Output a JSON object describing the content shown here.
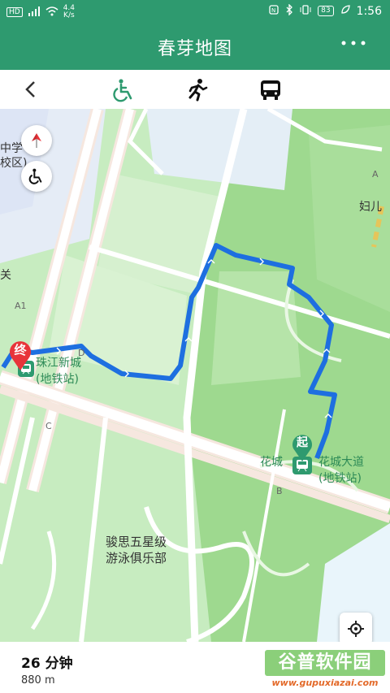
{
  "status_bar": {
    "network_badge": "HD",
    "signal": "4G",
    "speed_value": "4.4",
    "speed_unit": "K/s",
    "battery": "83",
    "time": "1:56"
  },
  "header": {
    "title": "春芽地图"
  },
  "mode_bar": {
    "active_mode": "wheelchair"
  },
  "map": {
    "labels": {
      "school_top": "中学",
      "school_bottom": "校区)",
      "guan": "关",
      "a1": "A1",
      "d": "D",
      "a_right": "A",
      "fuer": "妇儿",
      "c": "C",
      "b": "B",
      "zhujiang_1": "珠江新城",
      "zhujiang_2": "(地铁站)",
      "huacheng_left": "花城",
      "huacheng_1": "花城大道",
      "huacheng_2": "(地铁站)",
      "club_1": "骏思五星级",
      "club_2": "游泳俱乐部",
      "end_marker": "终",
      "start_marker": "起"
    },
    "route_color": "#1e6fe0"
  },
  "summary": {
    "duration": "26 分钟",
    "distance": "880 m"
  },
  "watermark": {
    "main": "谷普软件园",
    "url": "www.gupuxiazai.com"
  }
}
